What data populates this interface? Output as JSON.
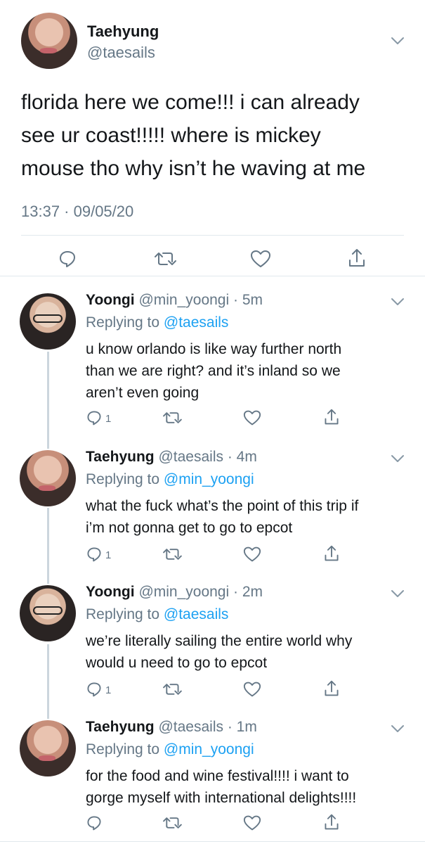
{
  "main_tweet": {
    "name": "Taehyung",
    "handle": "@taesails",
    "text": "florida here we come!!! i can already see ur coast!!!!! where is mickey mouse tho why isn’t he waving at me",
    "line1": "florida here we come!!! i can already",
    "line2": "see ur coast!!!!! where is mickey",
    "line3": "mouse tho why isn’t he waving at me",
    "timestamp": "13:37 · 09/05/20"
  },
  "replies": [
    {
      "name": "Yoongi",
      "handle": "@min_yoongi",
      "age": "· 5m",
      "replying_prefix": "Replying to",
      "replying_to": "@taesails",
      "line1": "u know orlando is like way further north",
      "line2": "than we are right? and it’s inland so we",
      "line3": "aren’t even going",
      "reply_count": "1"
    },
    {
      "name": "Taehyung",
      "handle": "@taesails",
      "age": "· 4m",
      "replying_prefix": "Replying to",
      "replying_to": "@min_yoongi",
      "line1": "what the fuck what’s the point of this trip if",
      "line2": "i’m not gonna get to go to epcot",
      "reply_count": "1"
    },
    {
      "name": "Yoongi",
      "handle": "@min_yoongi",
      "age": "· 2m",
      "replying_prefix": "Replying to",
      "replying_to": "@taesails",
      "line1": "we’re literally sailing the entire world why",
      "line2": "would u need to go to epcot",
      "reply_count": "1"
    },
    {
      "name": "Taehyung",
      "handle": "@taesails",
      "age": "· 1m",
      "replying_prefix": "Replying to",
      "replying_to": "@min_yoongi",
      "line1": "for the food and wine festival!!!! i want to",
      "line2": "gorge myself with international delights!!!!"
    }
  ],
  "icons": [
    "reply-icon",
    "retweet-icon",
    "like-icon",
    "share-icon",
    "chevron-down-icon"
  ],
  "colors": {
    "text": "#14171a",
    "secondary": "#657786",
    "link": "#1da1f2",
    "divider": "#e1e8ed",
    "thread_line": "#ccd6dd"
  }
}
